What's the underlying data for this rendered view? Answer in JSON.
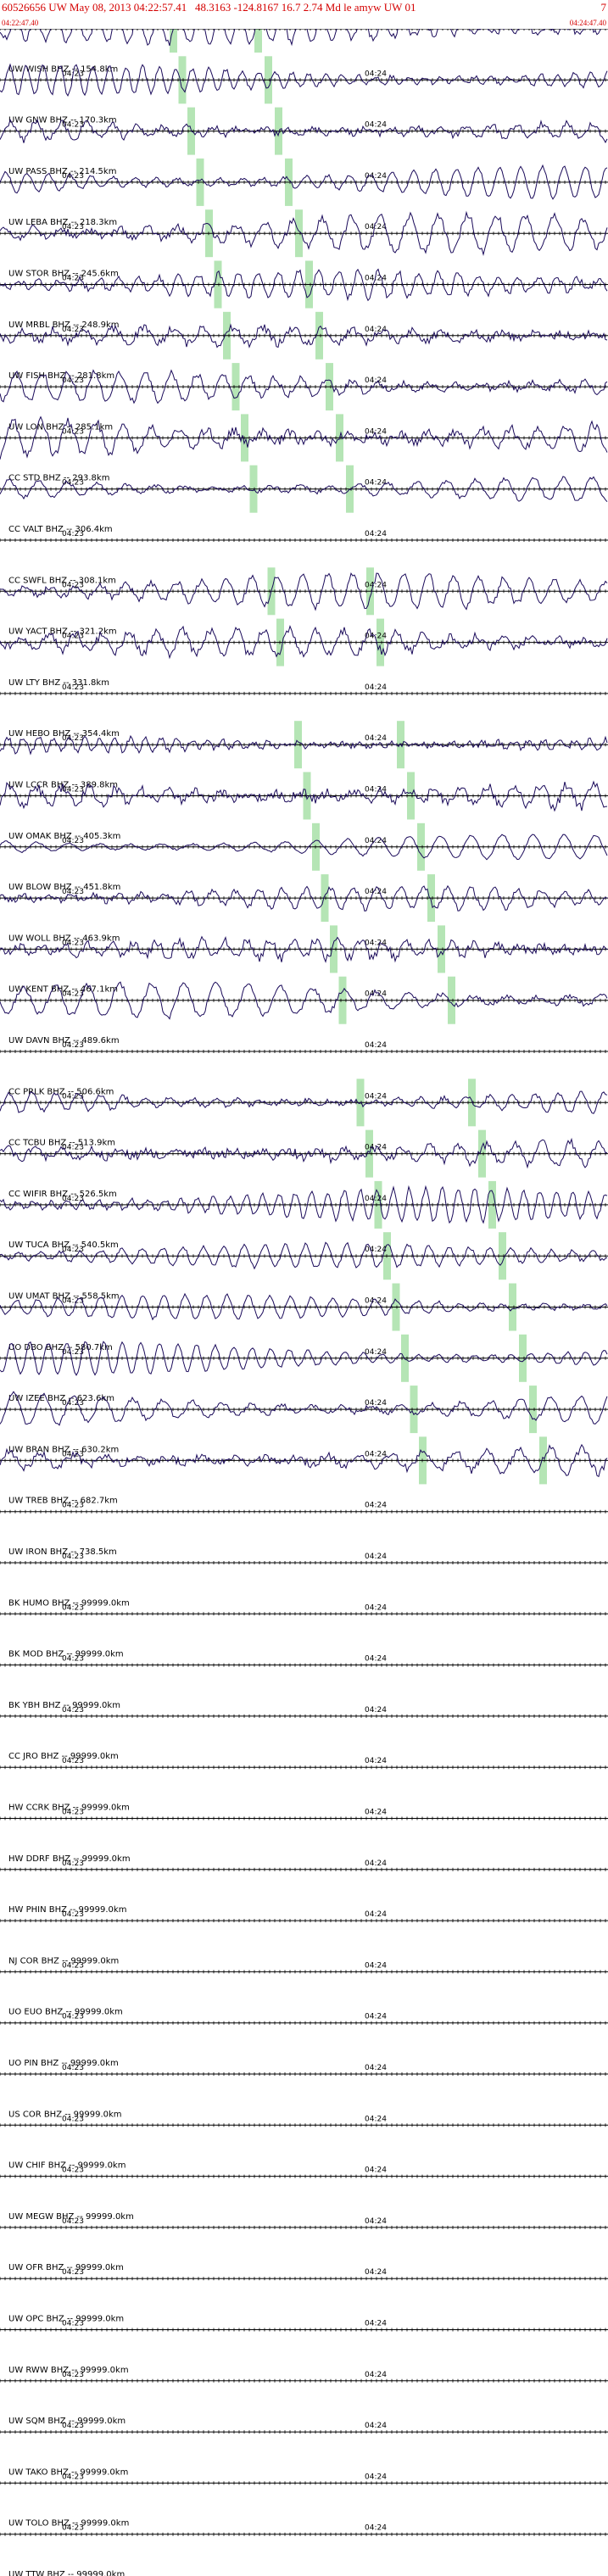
{
  "header": {
    "title": "60526656 UW May 08, 2013 04:22:57.41   48.3163 -124.8167 16.7 2.74 Md le amyw UW 01",
    "page": "7",
    "start_time": "04:22:47.40",
    "end_time": "04:24:47.40"
  },
  "chart_data": {
    "type": "line",
    "title": "60526656 UW May 08, 2013 04:22:57.41   48.3163 -124.8167 16.7 2.74 Md le amyw UW 01",
    "xlabel": "",
    "ylabel": "",
    "time_range": [
      "04:22:47.40",
      "04:24:47.40"
    ],
    "time_markers": [
      "04:23",
      "04:24"
    ],
    "trace_color": "#1a0a5a",
    "pick_color": "#a8e0a8",
    "grid": false,
    "traces": [
      {
        "label": "UW WISH BHZ -- 154.8km",
        "has_data": true
      },
      {
        "label": "UW GNW BHZ -- 170.3km",
        "has_data": true
      },
      {
        "label": "UW PASS BHZ -- 214.5km",
        "has_data": true
      },
      {
        "label": "UW LEBA BHZ -- 218.3km",
        "has_data": true
      },
      {
        "label": "UW STOR BHZ -- 245.6km",
        "has_data": true
      },
      {
        "label": "UW MRBL BHZ -- 248.9km",
        "has_data": true
      },
      {
        "label": "UW FISH BHZ -- 281.8km",
        "has_data": true
      },
      {
        "label": "UW LON BHZ -- 285.1km",
        "has_data": true
      },
      {
        "label": "CC STD BHZ -- 293.8km",
        "has_data": true
      },
      {
        "label": "CC VALT BHZ -- 306.4km",
        "has_data": true
      },
      {
        "label": "CC SWFL BHZ -- 308.1km",
        "has_data": false
      },
      {
        "label": "UW YACT BHZ -- 321.2km",
        "has_data": true
      },
      {
        "label": "UW LTY BHZ -- 331.8km",
        "has_data": true
      },
      {
        "label": "UW HEBO BHZ -- 354.4km",
        "has_data": false
      },
      {
        "label": "UW LCCR BHZ -- 389.8km",
        "has_data": true
      },
      {
        "label": "UW OMAK BHZ -- 405.3km",
        "has_data": true
      },
      {
        "label": "UW BLOW BHZ -- 451.8km",
        "has_data": true
      },
      {
        "label": "UW WOLL BHZ -- 463.9km",
        "has_data": true
      },
      {
        "label": "UW KENT BHZ -- 467.1km",
        "has_data": true
      },
      {
        "label": "UW DAVN BHZ -- 489.6km",
        "has_data": true
      },
      {
        "label": "CC PRLK BHZ -- 506.6km",
        "has_data": false
      },
      {
        "label": "CC TCBU BHZ -- 513.9km",
        "has_data": true
      },
      {
        "label": "CC WIFIR BHZ -- 526.5km",
        "has_data": true
      },
      {
        "label": "UW TUCA BHZ -- 540.5km",
        "has_data": true
      },
      {
        "label": "UW UMAT BHZ -- 558.5km",
        "has_data": true
      },
      {
        "label": "UO DBO BHZ -- 580.7km",
        "has_data": true
      },
      {
        "label": "UW IZEE BHZ -- 623.6km",
        "has_data": true
      },
      {
        "label": "UW BRAN BHZ -- 630.2km",
        "has_data": true
      },
      {
        "label": "UW TREB BHZ -- 682.7km",
        "has_data": true
      },
      {
        "label": "UW IRON BHZ -- 738.5km",
        "has_data": false
      },
      {
        "label": "BK HUMO BHZ -- 99999.0km",
        "has_data": false
      },
      {
        "label": "BK MOD BHZ -- 99999.0km",
        "has_data": false
      },
      {
        "label": "BK YBH BHZ -- 99999.0km",
        "has_data": false
      },
      {
        "label": "CC JRO BHZ -- 99999.0km",
        "has_data": false
      },
      {
        "label": "HW CCRK BHZ -- 99999.0km",
        "has_data": false
      },
      {
        "label": "HW DDRF BHZ -- 99999.0km",
        "has_data": false
      },
      {
        "label": "HW PHIN BHZ -- 99999.0km",
        "has_data": false
      },
      {
        "label": "NJ COR BHZ -- 99999.0km",
        "has_data": false
      },
      {
        "label": "UO EUO BHZ -- 99999.0km",
        "has_data": false
      },
      {
        "label": "UO PIN BHZ -- 99999.0km",
        "has_data": false
      },
      {
        "label": "US COR BHZ -- 99999.0km",
        "has_data": false
      },
      {
        "label": "UW CHIF BHZ -- 99999.0km",
        "has_data": false
      },
      {
        "label": "UW MEGW BHZ -- 99999.0km",
        "has_data": false
      },
      {
        "label": "UW OFR BHZ -- 99999.0km",
        "has_data": false
      },
      {
        "label": "UW OPC BHZ -- 99999.0km",
        "has_data": false
      },
      {
        "label": "UW RWW BHZ -- 99999.0km",
        "has_data": false
      },
      {
        "label": "UW SQM BHZ -- 99999.0km",
        "has_data": false
      },
      {
        "label": "UW TAKO BHZ -- 99999.0km",
        "has_data": false
      },
      {
        "label": "UW TOLO BHZ -- 99999.0km",
        "has_data": false
      },
      {
        "label": "UW TTW BHZ -- 99999.0km",
        "has_data": false
      }
    ]
  }
}
